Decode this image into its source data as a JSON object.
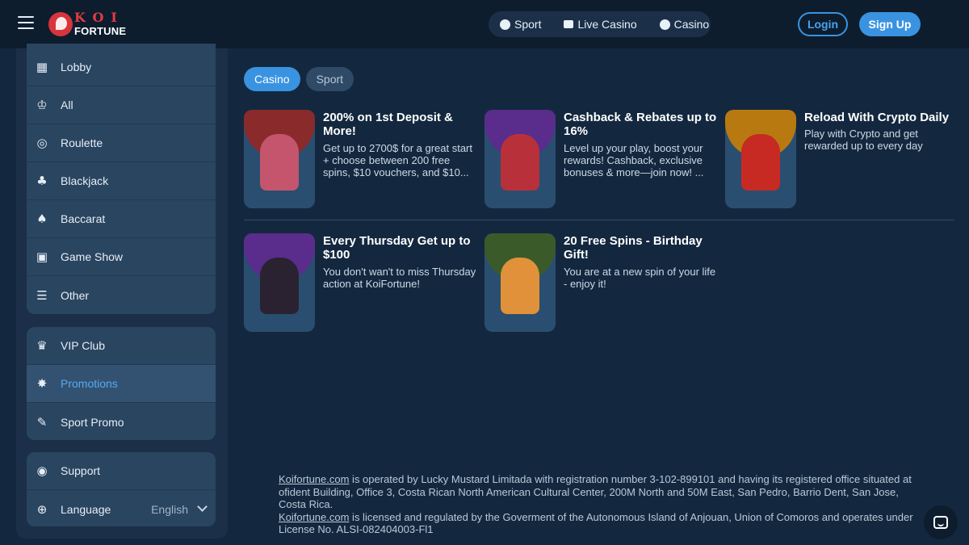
{
  "header": {
    "logo": {
      "top": "KOI",
      "bottom": "FORTUNE"
    },
    "nav": [
      {
        "label": "Sport",
        "icon": "soccer-ball-icon"
      },
      {
        "label": "Live Casino",
        "icon": "live-tv-icon"
      },
      {
        "label": "Casino",
        "icon": "casino-chip-icon"
      }
    ],
    "login_label": "Login",
    "signup_label": "Sign Up"
  },
  "sidebar": {
    "main_items": [
      {
        "label": "Lobby",
        "icon": "grid-icon"
      },
      {
        "label": "All",
        "icon": "trophy-icon"
      },
      {
        "label": "Roulette",
        "icon": "roulette-icon"
      },
      {
        "label": "Blackjack",
        "icon": "cards-icon"
      },
      {
        "label": "Baccarat",
        "icon": "baccarat-icon"
      },
      {
        "label": "Game Show",
        "icon": "presentation-icon"
      },
      {
        "label": "Other",
        "icon": "list-icon"
      }
    ],
    "promo_items": [
      {
        "label": "VIP Club",
        "icon": "crown-icon"
      },
      {
        "label": "Promotions",
        "icon": "star-burst-icon",
        "active": true
      },
      {
        "label": "Sport Promo",
        "icon": "ticket-icon"
      }
    ],
    "support_label": "Support",
    "language_label": "Language",
    "language_value": "English"
  },
  "tabs": [
    {
      "label": "Casino",
      "active": true
    },
    {
      "label": "Sport",
      "active": false
    }
  ],
  "promotions": [
    {
      "title": "200% on 1st Deposit & More!",
      "description": "Get up to 2700$ for a great start + choose between 200 free spins, $10 vouchers, and $10...",
      "blob_color": "#8a2a2a",
      "figure_color": "#c4556d"
    },
    {
      "title": "Cashback & Rebates up to 16%",
      "description": "Level up your play, boost your rewards! Cashback, exclusive bonuses & more—join now! ...",
      "blob_color": "#5a2c8c",
      "figure_color": "#b8313a"
    },
    {
      "title": "Reload With Crypto Daily",
      "description": "Play with Crypto and get rewarded up to every day",
      "blob_color": "#b87a10",
      "figure_color": "#c62a22"
    },
    {
      "title": "Every Thursday Get up to $100",
      "description": "You don't wan't to miss Thursday action at KoiFortune!",
      "blob_color": "#5a2c8c",
      "figure_color": "#2a2230"
    },
    {
      "title": "20 Free Spins - Birthday Gift!",
      "description": "You are at a new spin of your life - enjoy it!",
      "blob_color": "#3b5a2a",
      "figure_color": "#e0913a"
    }
  ],
  "footer": {
    "link1": "Koifortune.com",
    "text1": " is operated by Lucky Mustard Limitada with registration number 3-102-899101 and having its registered office situated at ofident Building, Office 3, Costa Rican North American Cultural Center, 200M North and 50M East, San Pedro, Barrio Dent, San Jose, Costa Rica.",
    "link2": "Koifortune.com",
    "text2": " is licensed and regulated by the Goverment of the Autonomous Island of Anjouan, Union of Comoros and operates under License No. ALSI-082404003-Fl1"
  }
}
